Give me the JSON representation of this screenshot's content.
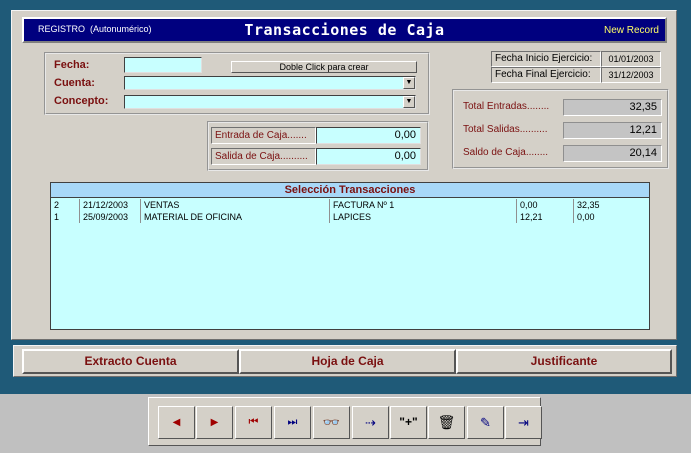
{
  "header": {
    "registro": "REGISTRO",
    "registro_note": "(Autonumérico)",
    "title": "Transacciones de Caja",
    "record_status": "New Record"
  },
  "form": {
    "fecha_label": "Fecha:",
    "cuenta_label": "Cuenta:",
    "concepto_label": "Concepto:",
    "fecha_value": "",
    "cuenta_value": "",
    "concepto_value": "",
    "doble_click": "Doble Click para crear"
  },
  "ejercicio": {
    "inicio_label": "Fecha Inicio Ejercicio:",
    "inicio_value": "01/01/2003",
    "final_label": "Fecha Final  Ejercicio:",
    "final_value": "31/12/2003"
  },
  "movimiento": {
    "entrada_label": "Entrada de Caja.......",
    "entrada_value": "0,00",
    "salida_label": "Salida de Caja..........",
    "salida_value": "0,00"
  },
  "totales": {
    "entradas_label": "Total Entradas........",
    "entradas_value": "32,35",
    "salidas_label": "Total Salidas..........",
    "salidas_value": "12,21",
    "saldo_label": "Saldo de Caja........",
    "saldo_value": "20,14"
  },
  "list": {
    "header": "Selección Transacciones",
    "rows": [
      {
        "id": "2",
        "fecha": "21/12/2003",
        "cuenta": "VENTAS",
        "concepto": "FACTURA Nº 1",
        "salida": "0,00",
        "entrada": "32,35"
      },
      {
        "id": "1",
        "fecha": "25/09/2003",
        "cuenta": "MATERIAL DE OFICINA",
        "concepto": "LAPICES",
        "salida": "12,21",
        "entrada": "0,00"
      }
    ]
  },
  "actions": {
    "extracto": "Extracto Cuenta",
    "hoja": "Hoja de Caja",
    "justificante": "Justificante"
  },
  "toolbar": {
    "prev": "◀",
    "next": "▶",
    "first": "⏮",
    "last": "⏭",
    "find": "👓",
    "find_next": "⇢",
    "new": "\"+\"",
    "delete": "🗑",
    "edit": "✎",
    "exit": "⇥"
  },
  "colors": {
    "accent": "#00007f",
    "label": "#7a1010",
    "field": "#c8ffff",
    "list_header": "#a8d8f8"
  }
}
